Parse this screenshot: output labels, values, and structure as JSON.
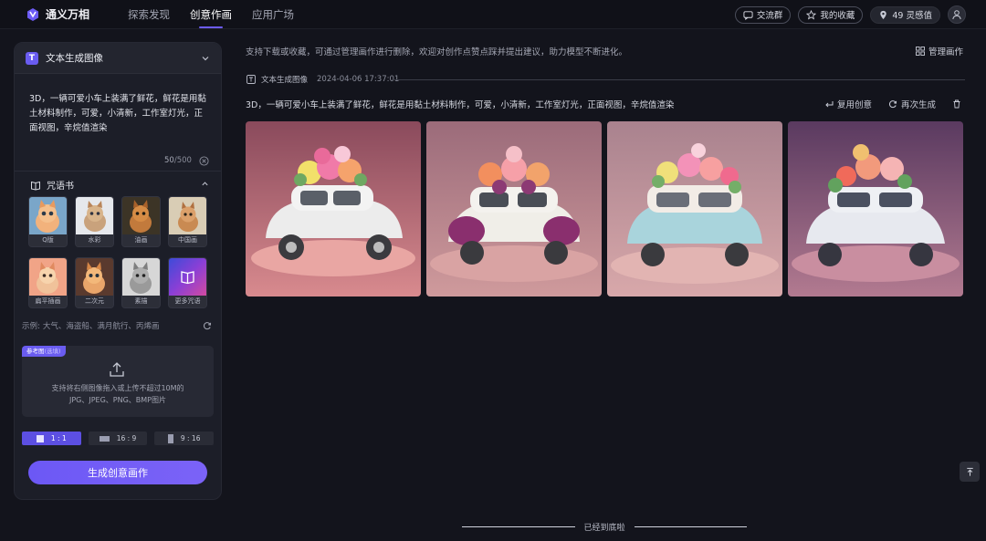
{
  "app": {
    "name": "通义万相"
  },
  "nav": [
    {
      "label": "探索发现"
    },
    {
      "label": "创意作画"
    },
    {
      "label": "应用广场"
    }
  ],
  "header": {
    "group_label": "交流群",
    "favorites_label": "我的收藏",
    "points_label": "49 灵感值"
  },
  "panel": {
    "mode_label": "文本生成图像",
    "mode_icon_letter": "T",
    "prompt": "3D，一辆可爱小车上装满了鲜花，鲜花是用黏土材料制作，可爱，小清新，工作室灯光，正面视图，辛烷值渲染",
    "count_current": "50",
    "count_max": "/500",
    "spellbook_label": "咒语书",
    "styles": [
      {
        "label": "Q版"
      },
      {
        "label": "水彩"
      },
      {
        "label": "油画"
      },
      {
        "label": "中国画"
      },
      {
        "label": "扁平插画"
      },
      {
        "label": "二次元"
      },
      {
        "label": "素描"
      },
      {
        "label": "更多咒语"
      }
    ],
    "examples_label": "示例:",
    "examples": "大气、海盗船、满月航行、丙烯画",
    "reference": {
      "tag": "参考图",
      "tag_optional": "(选填)",
      "line1": "支持将右侧图像拖入或上传不超过10M的",
      "line2": "JPG、JPEG、PNG、BMP图片"
    },
    "ratios": [
      {
        "label": "1 : 1",
        "active": true
      },
      {
        "label": "16 : 9",
        "active": false
      },
      {
        "label": "9 : 16",
        "active": false
      }
    ],
    "generate_label": "生成创意画作"
  },
  "main": {
    "tip": "支持下载或收藏，可通过管理画作进行删除，欢迎对创作点赞点踩并提出建议，助力模型不断进化。",
    "manage_label": "管理画作",
    "record": {
      "mode_label": "文本生成图像",
      "date": "2024-04-06 17:37:01",
      "prompt": "3D，一辆可爱小车上装满了鲜花，鲜花是用黏土材料制作，可爱，小清新，工作室灯光，正面视图，辛烷值渲染",
      "reuse_label": "复用创意",
      "regenerate_label": "再次生成"
    }
  },
  "footer": {
    "end_label": "已经到底啦"
  },
  "colors": {
    "accent": "#6c58f5",
    "background": "#13141c",
    "panel": "#1c1e28"
  }
}
